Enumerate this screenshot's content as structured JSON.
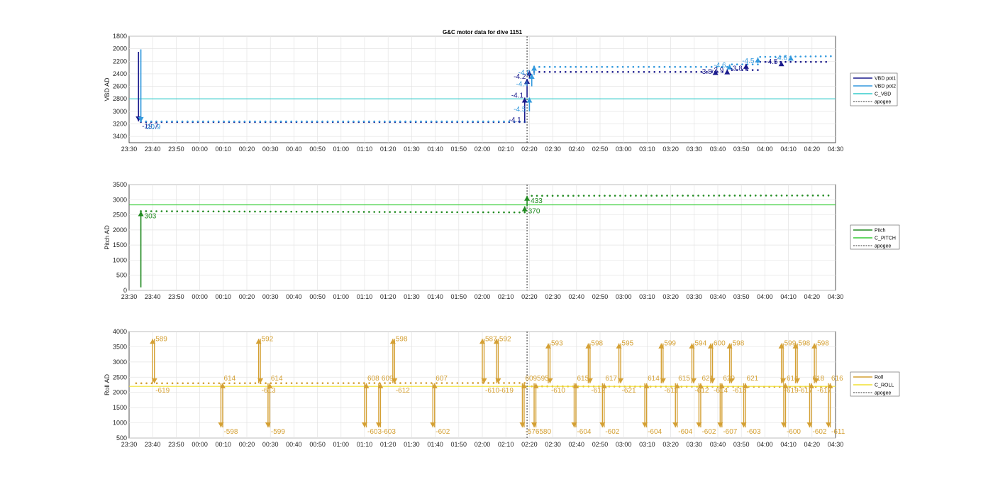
{
  "title": "G&C motor data for dive 1151",
  "x_ticks": [
    "23:30",
    "23:40",
    "23:50",
    "00:00",
    "00:10",
    "00:20",
    "00:30",
    "00:40",
    "00:50",
    "01:00",
    "01:10",
    "01:20",
    "01:30",
    "01:40",
    "01:50",
    "02:00",
    "02:10",
    "02:20",
    "02:30",
    "02:40",
    "02:50",
    "03:00",
    "03:10",
    "03:20",
    "03:30",
    "03:40",
    "03:50",
    "04:00",
    "04:10",
    "04:20",
    "04:30"
  ],
  "colors": {
    "vbd_pot1": "#1a1a8c",
    "vbd_pot2": "#3399dd",
    "c_vbd": "#33cccc",
    "pitch": "#228b22",
    "c_pitch": "#33cc33",
    "roll": "#d4a034",
    "c_roll": "#f0e030",
    "apogee": "#333333"
  },
  "chart_data": [
    {
      "type": "line",
      "ylabel": "VBD AD",
      "ylim": [
        3500,
        1800
      ],
      "y_reversed": true,
      "y_ticks": [
        1800,
        2000,
        2200,
        2400,
        2600,
        2800,
        3000,
        3200,
        3400
      ],
      "xlim": [
        "23:30",
        "04:30"
      ],
      "grid": true,
      "legend": {
        "placement": "right",
        "entries": [
          "VBD pot1",
          "VBD pot2",
          "C_VBD",
          "apogee"
        ]
      },
      "series": [
        {
          "name": "VBD pot1",
          "baseline_segments": [
            [
              "23:35",
              3170,
              "02:18",
              3170
            ],
            [
              "02:22",
              2370,
              "03:42",
              2370
            ],
            [
              "03:46",
              2340,
              "03:57",
              2340
            ],
            [
              "03:58",
              2210,
              "04:26",
              2210
            ]
          ]
        },
        {
          "name": "VBD pot2",
          "baseline_segments": [
            [
              "23:35",
              3160,
              "02:18",
              3160
            ],
            [
              "02:22",
              2290,
              "03:44",
              2290
            ],
            [
              "03:46",
              2250,
              "03:57",
              2250
            ],
            [
              "03:58",
              2130,
              "04:28",
              2120
            ]
          ]
        },
        {
          "name": "C_VBD",
          "y": 2800
        },
        {
          "name": "apogee",
          "x": "02:19"
        }
      ],
      "moves": [
        {
          "x": "23:34",
          "from": 2050,
          "to": 3160,
          "series": "VBD pot1",
          "label": "-19.7"
        },
        {
          "x": "23:35",
          "from": 2010,
          "to": 3170,
          "series": "VBD pot2",
          "label": "-20.9"
        },
        {
          "x": "02:18",
          "from": 3170,
          "to": 2780,
          "series": "VBD pot1",
          "label": "-4.1"
        },
        {
          "x": "02:19",
          "from": 2780,
          "to": 2480,
          "series": "VBD pot1",
          "label": "-4.1"
        },
        {
          "x": "02:20",
          "from": 2480,
          "to": 2350,
          "series": "VBD pot1",
          "label": "-4.2"
        },
        {
          "x": "02:20",
          "from": 3000,
          "to": 2780,
          "series": "VBD pot2",
          "label": "-4.5"
        },
        {
          "x": "02:21",
          "from": 2600,
          "to": 2400,
          "series": "VBD pot2",
          "label": "-4.4"
        },
        {
          "x": "02:22",
          "from": 2420,
          "to": 2270,
          "series": "VBD pot2",
          "label": "-4.0"
        },
        {
          "x": "03:39",
          "from": 2400,
          "to": 2340,
          "series": "VBD pot1",
          "label": "-3.8"
        },
        {
          "x": "03:44",
          "from": 2380,
          "to": 2330,
          "series": "VBD pot1",
          "label": "-3.9"
        },
        {
          "x": "03:45",
          "from": 2300,
          "to": 2250,
          "series": "VBD pot2",
          "label": "-4.6"
        },
        {
          "x": "03:52",
          "from": 2350,
          "to": 2240,
          "series": "VBD pot1",
          "label": "-3.8"
        },
        {
          "x": "03:57",
          "from": 2230,
          "to": 2140,
          "series": "VBD pot2",
          "label": "-4.5"
        },
        {
          "x": "04:07",
          "from": 2240,
          "to": 2200,
          "series": "VBD pot1",
          "label": "-4.5"
        },
        {
          "x": "04:11",
          "from": 2180,
          "to": 2110,
          "series": "VBD pot2",
          "label": "-4.6"
        }
      ]
    },
    {
      "type": "line",
      "ylabel": "Pitch AD",
      "ylim": [
        0,
        3500
      ],
      "y_ticks": [
        0,
        500,
        1000,
        1500,
        2000,
        2500,
        3000,
        3500
      ],
      "xlim": [
        "23:30",
        "04:30"
      ],
      "grid": true,
      "legend": {
        "placement": "right",
        "entries": [
          "Pitch",
          "C_PITCH",
          "apogee"
        ]
      },
      "series": [
        {
          "name": "Pitch",
          "baseline_segments": [
            [
              "23:35",
              2620,
              "02:18",
              2580
            ],
            [
              "02:21",
              3130,
              "04:27",
              3140
            ]
          ]
        },
        {
          "name": "C_PITCH",
          "y": 2830
        },
        {
          "name": "apogee",
          "x": "02:19"
        }
      ],
      "moves": [
        {
          "x": "23:35",
          "from": 100,
          "to": 2620,
          "series": "Pitch",
          "label": "303"
        },
        {
          "x": "02:18",
          "from": 2580,
          "to": 2780,
          "series": "Pitch",
          "label": "370"
        },
        {
          "x": "02:19",
          "from": 2780,
          "to": 3130,
          "series": "Pitch",
          "label": "433"
        }
      ]
    },
    {
      "type": "line",
      "ylabel": "Roll AD",
      "ylim": [
        500,
        4000
      ],
      "y_ticks": [
        500,
        1000,
        1500,
        2000,
        2500,
        3000,
        3500,
        4000
      ],
      "xlim": [
        "23:30",
        "04:30"
      ],
      "grid": true,
      "legend": {
        "placement": "right",
        "entries": [
          "Roll",
          "C_ROLL",
          "apogee"
        ]
      },
      "series": [
        {
          "name": "Roll",
          "baseline_segments": [
            [
              "23:33",
              2300,
              "02:18",
              2310
            ],
            [
              "02:21",
              2200,
              "04:26",
              2180
            ]
          ]
        },
        {
          "name": "C_ROLL",
          "y": 2200
        },
        {
          "name": "apogee",
          "x": "02:19"
        }
      ],
      "pulses": [
        {
          "x": "23:40",
          "peak": 3760,
          "up_label": "589",
          "down_label": "-619"
        },
        {
          "x": "00:09",
          "peak": 850,
          "up_label": "614",
          "down_label": "-598"
        },
        {
          "x": "00:25",
          "peak": 3760,
          "up_label": "592",
          "down_label": "-613"
        },
        {
          "x": "00:29",
          "peak": 850,
          "up_label": "614",
          "down_label": "-599"
        },
        {
          "x": "01:10",
          "peak": 850,
          "up_label": "608",
          "down_label": "-603"
        },
        {
          "x": "01:16",
          "peak": 850,
          "up_label": "609",
          "down_label": "-603"
        },
        {
          "x": "01:22",
          "peak": 3760,
          "up_label": "598",
          "down_label": "-612"
        },
        {
          "x": "01:39",
          "peak": 850,
          "up_label": "607",
          "down_label": "-602"
        },
        {
          "x": "02:00",
          "peak": 3760,
          "up_label": "587",
          "down_label": "-610"
        },
        {
          "x": "02:06",
          "peak": 3760,
          "up_label": "592",
          "down_label": "-619"
        },
        {
          "x": "02:17",
          "peak": 850,
          "up_label": "609",
          "down_label": "-576"
        },
        {
          "x": "02:22",
          "peak": 850,
          "up_label": "595",
          "down_label": "-580"
        },
        {
          "x": "02:28",
          "peak": 3610,
          "up_label": "593",
          "down_label": "-610"
        },
        {
          "x": "02:39",
          "peak": 850,
          "up_label": "615",
          "down_label": "-604"
        },
        {
          "x": "02:45",
          "peak": 3610,
          "up_label": "598",
          "down_label": "-612"
        },
        {
          "x": "02:51",
          "peak": 850,
          "up_label": "617",
          "down_label": "-602"
        },
        {
          "x": "02:58",
          "peak": 3610,
          "up_label": "595",
          "down_label": "-621"
        },
        {
          "x": "03:09",
          "peak": 850,
          "up_label": "614",
          "down_label": "-604"
        },
        {
          "x": "03:16",
          "peak": 3610,
          "up_label": "599",
          "down_label": "-611"
        },
        {
          "x": "03:22",
          "peak": 850,
          "up_label": "615",
          "down_label": "-604"
        },
        {
          "x": "03:29",
          "peak": 3610,
          "up_label": "594",
          "down_label": "-612"
        },
        {
          "x": "03:32",
          "peak": 850,
          "up_label": "621",
          "down_label": "-602"
        },
        {
          "x": "03:37",
          "peak": 3610,
          "up_label": "600",
          "down_label": "-614"
        },
        {
          "x": "03:41",
          "peak": 850,
          "up_label": "620",
          "down_label": "-607"
        },
        {
          "x": "03:45",
          "peak": 3610,
          "up_label": "598",
          "down_label": "-615"
        },
        {
          "x": "03:51",
          "peak": 850,
          "up_label": "621",
          "down_label": "-603"
        },
        {
          "x": "04:07",
          "peak": 3610,
          "up_label": "599",
          "down_label": "-619"
        },
        {
          "x": "04:08",
          "peak": 850,
          "up_label": "614",
          "down_label": "-600"
        },
        {
          "x": "04:13",
          "peak": 3610,
          "up_label": "598",
          "down_label": "-617"
        },
        {
          "x": "04:19",
          "peak": 850,
          "up_label": "618",
          "down_label": "-602"
        },
        {
          "x": "04:21",
          "peak": 3610,
          "up_label": "598",
          "down_label": "-617"
        },
        {
          "x": "04:27",
          "peak": 850,
          "up_label": "616",
          "down_label": "-611"
        }
      ]
    }
  ]
}
